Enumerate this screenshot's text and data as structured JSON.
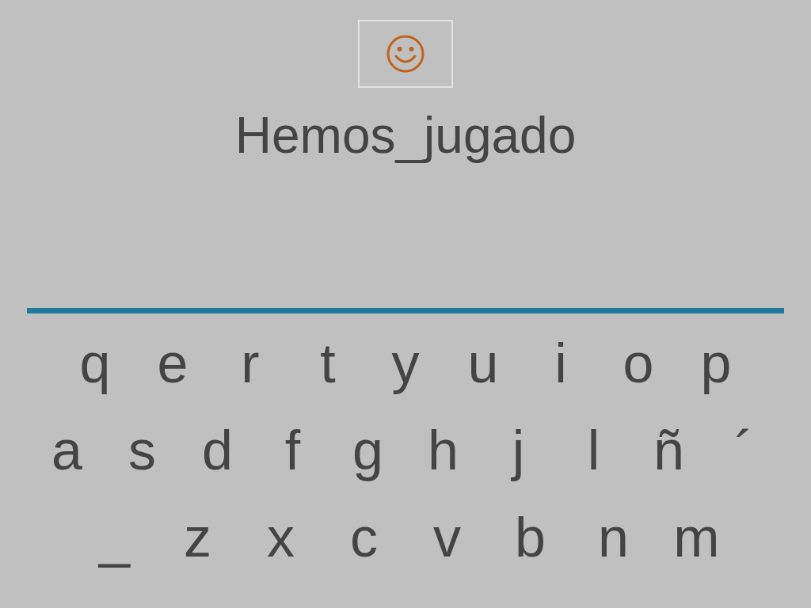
{
  "word": "Hemos_jugado",
  "keyboard": [
    [
      "q",
      "e",
      "r",
      "t",
      "y",
      "u",
      "i",
      "o",
      "p"
    ],
    [
      "a",
      "s",
      "d",
      "f",
      "g",
      "h",
      "j",
      "l",
      "ñ",
      "´"
    ],
    [
      "_",
      "z",
      "x",
      "c",
      "v",
      "b",
      "n",
      "m"
    ]
  ]
}
